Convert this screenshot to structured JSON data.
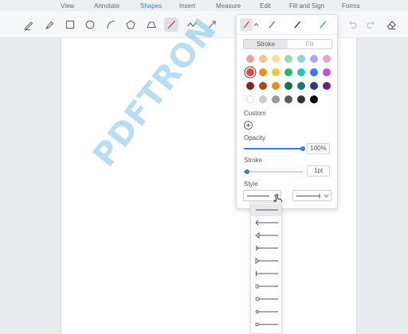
{
  "menu": {
    "items": [
      {
        "label": "View",
        "active": false
      },
      {
        "label": "Annotate",
        "active": false
      },
      {
        "label": "Shapes",
        "active": true
      },
      {
        "label": "Insert",
        "active": false
      },
      {
        "label": "Measure",
        "active": false
      },
      {
        "label": "Edit",
        "active": false
      },
      {
        "label": "Fill and Sign",
        "active": false
      },
      {
        "label": "Forms",
        "active": false
      }
    ]
  },
  "toolbar": {
    "tools": [
      "pen-icon",
      "highlighter-icon",
      "rectangle-icon",
      "circle-icon",
      "arc-icon",
      "pentagon-icon",
      "cloud-icon",
      "line-icon",
      "polyline-icon",
      "arrow-icon"
    ],
    "selected_tool": "line-icon",
    "right_tools": [
      "undo-icon",
      "redo-icon",
      "eraser-icon"
    ]
  },
  "watermark": "PDFTRON",
  "style_panel": {
    "presets": [
      {
        "icon": "line-preset-icon",
        "color": "#e03a3a",
        "active": true
      },
      {
        "icon": "line-preset-icon",
        "color": "#3a6fd8",
        "active": false
      },
      {
        "icon": "line-preset-icon",
        "color": "#222222",
        "active": false
      },
      {
        "icon": "line-preset-icon",
        "color": "#2a8a5c",
        "active": false
      }
    ],
    "tabs": [
      {
        "label": "Stroke",
        "active": true
      },
      {
        "label": "Fill",
        "active": false
      }
    ],
    "swatches": [
      "#f0a09c",
      "#f6c289",
      "#f8e09b",
      "#8fdcb3",
      "#88ddd3",
      "#a9a8ec",
      "#e49fe6",
      "#e44b3f",
      "#f08c25",
      "#f4c536",
      "#26b86a",
      "#28c3b6",
      "#4b74df",
      "#c24ed8",
      "#8b2317",
      "#a64a16",
      "#e0951a",
      "#187243",
      "#177a72",
      "#2b3a8c",
      "#6f2085",
      "#ffffff",
      "#cdcdcd",
      "#9a9a9a",
      "#5d5d5d",
      "#333333",
      "#000000"
    ],
    "selected_swatch": 7,
    "custom_label": "Custom",
    "opacity_label": "Opacity",
    "opacity_value": "100%",
    "opacity_level": 1.0,
    "stroke_label": "Stroke",
    "stroke_value": "1pt",
    "stroke_level": 0.05,
    "style_label": "Style"
  },
  "dropdown": {
    "options": [
      "solid",
      "arrow-open",
      "arrow-closed",
      "arrow-open-reverse",
      "arrow-closed-reverse",
      "butt",
      "square",
      "circle",
      "diamond",
      "square-small",
      "slash"
    ],
    "selected": 0
  }
}
